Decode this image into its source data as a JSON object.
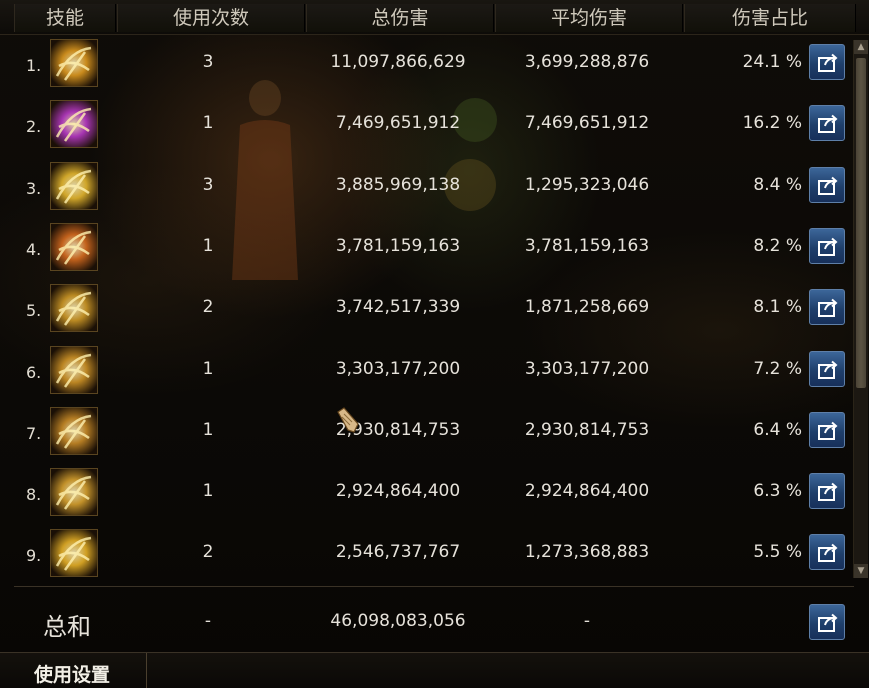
{
  "headers": {
    "skill": "技能",
    "uses": "使用次数",
    "total_damage": "总伤害",
    "avg_damage": "平均伤害",
    "damage_share": "伤害占比"
  },
  "rows": [
    {
      "rank": "1.",
      "uses": "3",
      "total": "11,097,866,629",
      "avg": "3,699,288,876",
      "pct": "24.1 %",
      "icon": "claw-slash-skill-icon",
      "color": "#e8a020"
    },
    {
      "rank": "2.",
      "uses": "1",
      "total": "7,469,651,912",
      "avg": "7,469,651,912",
      "pct": "16.2 %",
      "icon": "purple-vortex-skill-icon",
      "color": "#c03cd0"
    },
    {
      "rank": "3.",
      "uses": "3",
      "total": "3,885,969,138",
      "avg": "1,295,323,046",
      "pct": "8.4 %",
      "icon": "star-burst-skill-icon",
      "color": "#f0c030"
    },
    {
      "rank": "4.",
      "uses": "1",
      "total": "3,781,159,163",
      "avg": "3,781,159,163",
      "pct": "8.2 %",
      "icon": "chain-flame-skill-icon",
      "color": "#e07020"
    },
    {
      "rank": "5.",
      "uses": "2",
      "total": "3,742,517,339",
      "avg": "1,871,258,669",
      "pct": "8.1 %",
      "icon": "golden-slash-skill-icon",
      "color": "#d8a028"
    },
    {
      "rank": "6.",
      "uses": "1",
      "total": "3,303,177,200",
      "avg": "3,303,177,200",
      "pct": "7.2 %",
      "icon": "spiral-wind-skill-icon",
      "color": "#d89a28"
    },
    {
      "rank": "7.",
      "uses": "1",
      "total": "2,930,814,753",
      "avg": "2,930,814,753",
      "pct": "6.4 %",
      "icon": "crossed-blades-skill-icon",
      "color": "#d09028"
    },
    {
      "rank": "8.",
      "uses": "1",
      "total": "2,924,864,400",
      "avg": "2,924,864,400",
      "pct": "6.3 %",
      "icon": "radiant-fan-skill-icon",
      "color": "#e0a830"
    },
    {
      "rank": "9.",
      "uses": "2",
      "total": "2,546,737,767",
      "avg": "1,273,368,883",
      "pct": "5.5 %",
      "icon": "lightning-strike-skill-icon",
      "color": "#f0b828"
    }
  ],
  "summary": {
    "label": "总和",
    "uses": "-",
    "total": "46,098,083,056",
    "avg": "-"
  },
  "bottom": {
    "tab_label": "使用设置"
  },
  "colors": {
    "accent_button": "#2a5080",
    "text": "#e6e2da",
    "header_text": "#cfc9bb"
  }
}
